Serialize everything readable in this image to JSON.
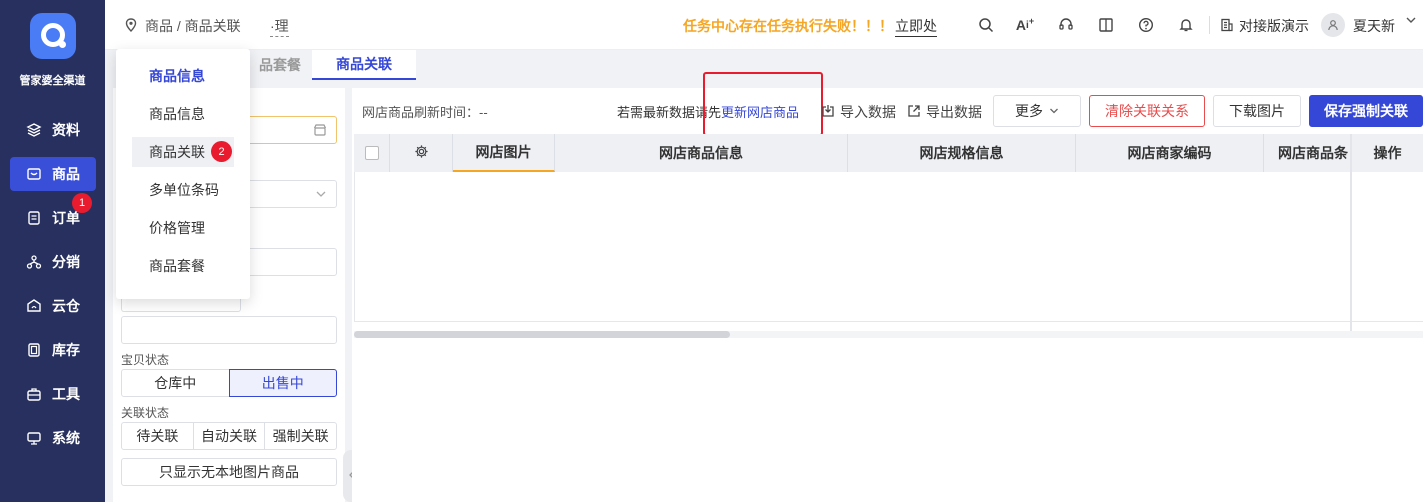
{
  "sidebar": {
    "brand": "管家婆全渠道",
    "items": [
      {
        "label": "资料",
        "icon": "layers-icon"
      },
      {
        "label": "商品",
        "icon": "box-icon"
      },
      {
        "label": "订单",
        "icon": "document-icon",
        "badge": "1"
      },
      {
        "label": "分销",
        "icon": "network-icon"
      },
      {
        "label": "云仓",
        "icon": "cloud-warehouse-icon"
      },
      {
        "label": "库存",
        "icon": "inventory-icon"
      },
      {
        "label": "工具",
        "icon": "toolbox-icon"
      },
      {
        "label": "系统",
        "icon": "monitor-icon"
      }
    ]
  },
  "header": {
    "breadcrumb": "商品 / 商品关联",
    "breadcrumb_extra": "·理",
    "alert": "任务中心存在任务执行失败！！！",
    "alert_link": "立即处",
    "company": "对接版演示",
    "username": "夏天新"
  },
  "tabs": [
    {
      "label": "品套餐"
    },
    {
      "label": "商品关联"
    }
  ],
  "dropdown": {
    "items": [
      {
        "label": "商品信息"
      },
      {
        "label": "商品信息"
      },
      {
        "label": "商品关联",
        "badge": "2"
      },
      {
        "label": "多单位条码"
      },
      {
        "label": "价格管理"
      },
      {
        "label": "商品套餐"
      }
    ]
  },
  "filters": {
    "status_label": "宝贝状态",
    "status_options": [
      "仓库中",
      "出售中"
    ],
    "link_label": "关联状态",
    "link_options": [
      "待关联",
      "自动关联",
      "强制关联"
    ],
    "only_no_image_button": "只显示无本地图片商品"
  },
  "toolbar": {
    "refresh_time": "网店商品刷新时间：--",
    "hint_prefix": "若需最新数据请先",
    "hint_link": "更新网店商品",
    "import": "导入数据",
    "export": "导出数据",
    "more": "更多",
    "clear": "清除关联关系",
    "download": "下载图片",
    "save": "保存强制关联"
  },
  "table": {
    "columns": [
      "网店图片",
      "网店商品信息",
      "网店规格信息",
      "网店商家编码",
      "网店商品条",
      "操作"
    ]
  },
  "colors": {
    "sidebar_bg": "#27305e",
    "accent": "#3547d6",
    "alert": "#f5a623",
    "danger": "#e81c2e"
  }
}
